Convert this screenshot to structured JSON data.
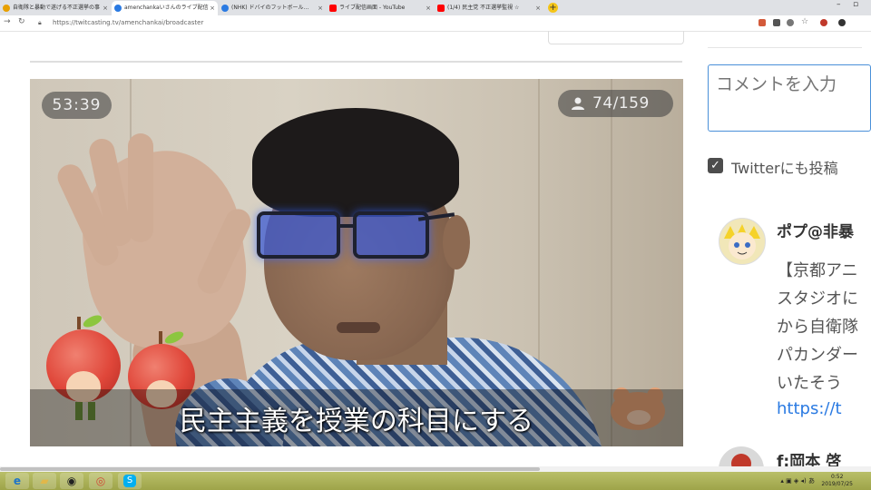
{
  "browser": {
    "tabs": [
      {
        "label": "自衛隊と暴動で遂げる不正選挙の事",
        "favicon_color": "#e8a000"
      },
      {
        "label": "amenchankaいさんのライブ配信",
        "favicon_color": "#2a7ae2"
      },
      {
        "label": "(NHK) ドバイのフットボール…",
        "favicon_color": "#2a7ae2"
      },
      {
        "label": "ライブ配信画面 - YouTube",
        "favicon_color": "#ff0000"
      },
      {
        "label": "(1/4) 民主党 不正選挙監視 ☆",
        "favicon_color": "#ff0000"
      }
    ],
    "url": "https://twitcasting.tv/amenchankai/broadcaster"
  },
  "player": {
    "elapsed": "53:39",
    "viewers": "74/159",
    "caption": "民主主義を授業の科目にする"
  },
  "comment_form": {
    "placeholder": "コメントを入力",
    "twitter_label": "Twitterにも投稿"
  },
  "comments": [
    {
      "name": "ポプ@非暴",
      "lines": [
        "【京都アニ",
        "スタジオに",
        "から自衛隊",
        "パカンダー",
        "いたそう"
      ],
      "link": "https://t"
    },
    {
      "name": "f:岡本 啓",
      "lines": [],
      "link": ""
    }
  ],
  "taskbar": {
    "clock_time": "0:52",
    "clock_date": "2019/07/25",
    "apps": [
      "ie-icon",
      "file-explorer-icon",
      "media-icon",
      "chrome-icon",
      "skype-icon"
    ]
  },
  "colors": {
    "accent": "#4a90d9",
    "link": "#2a7ae2",
    "taskbar": "#b9bf69"
  }
}
